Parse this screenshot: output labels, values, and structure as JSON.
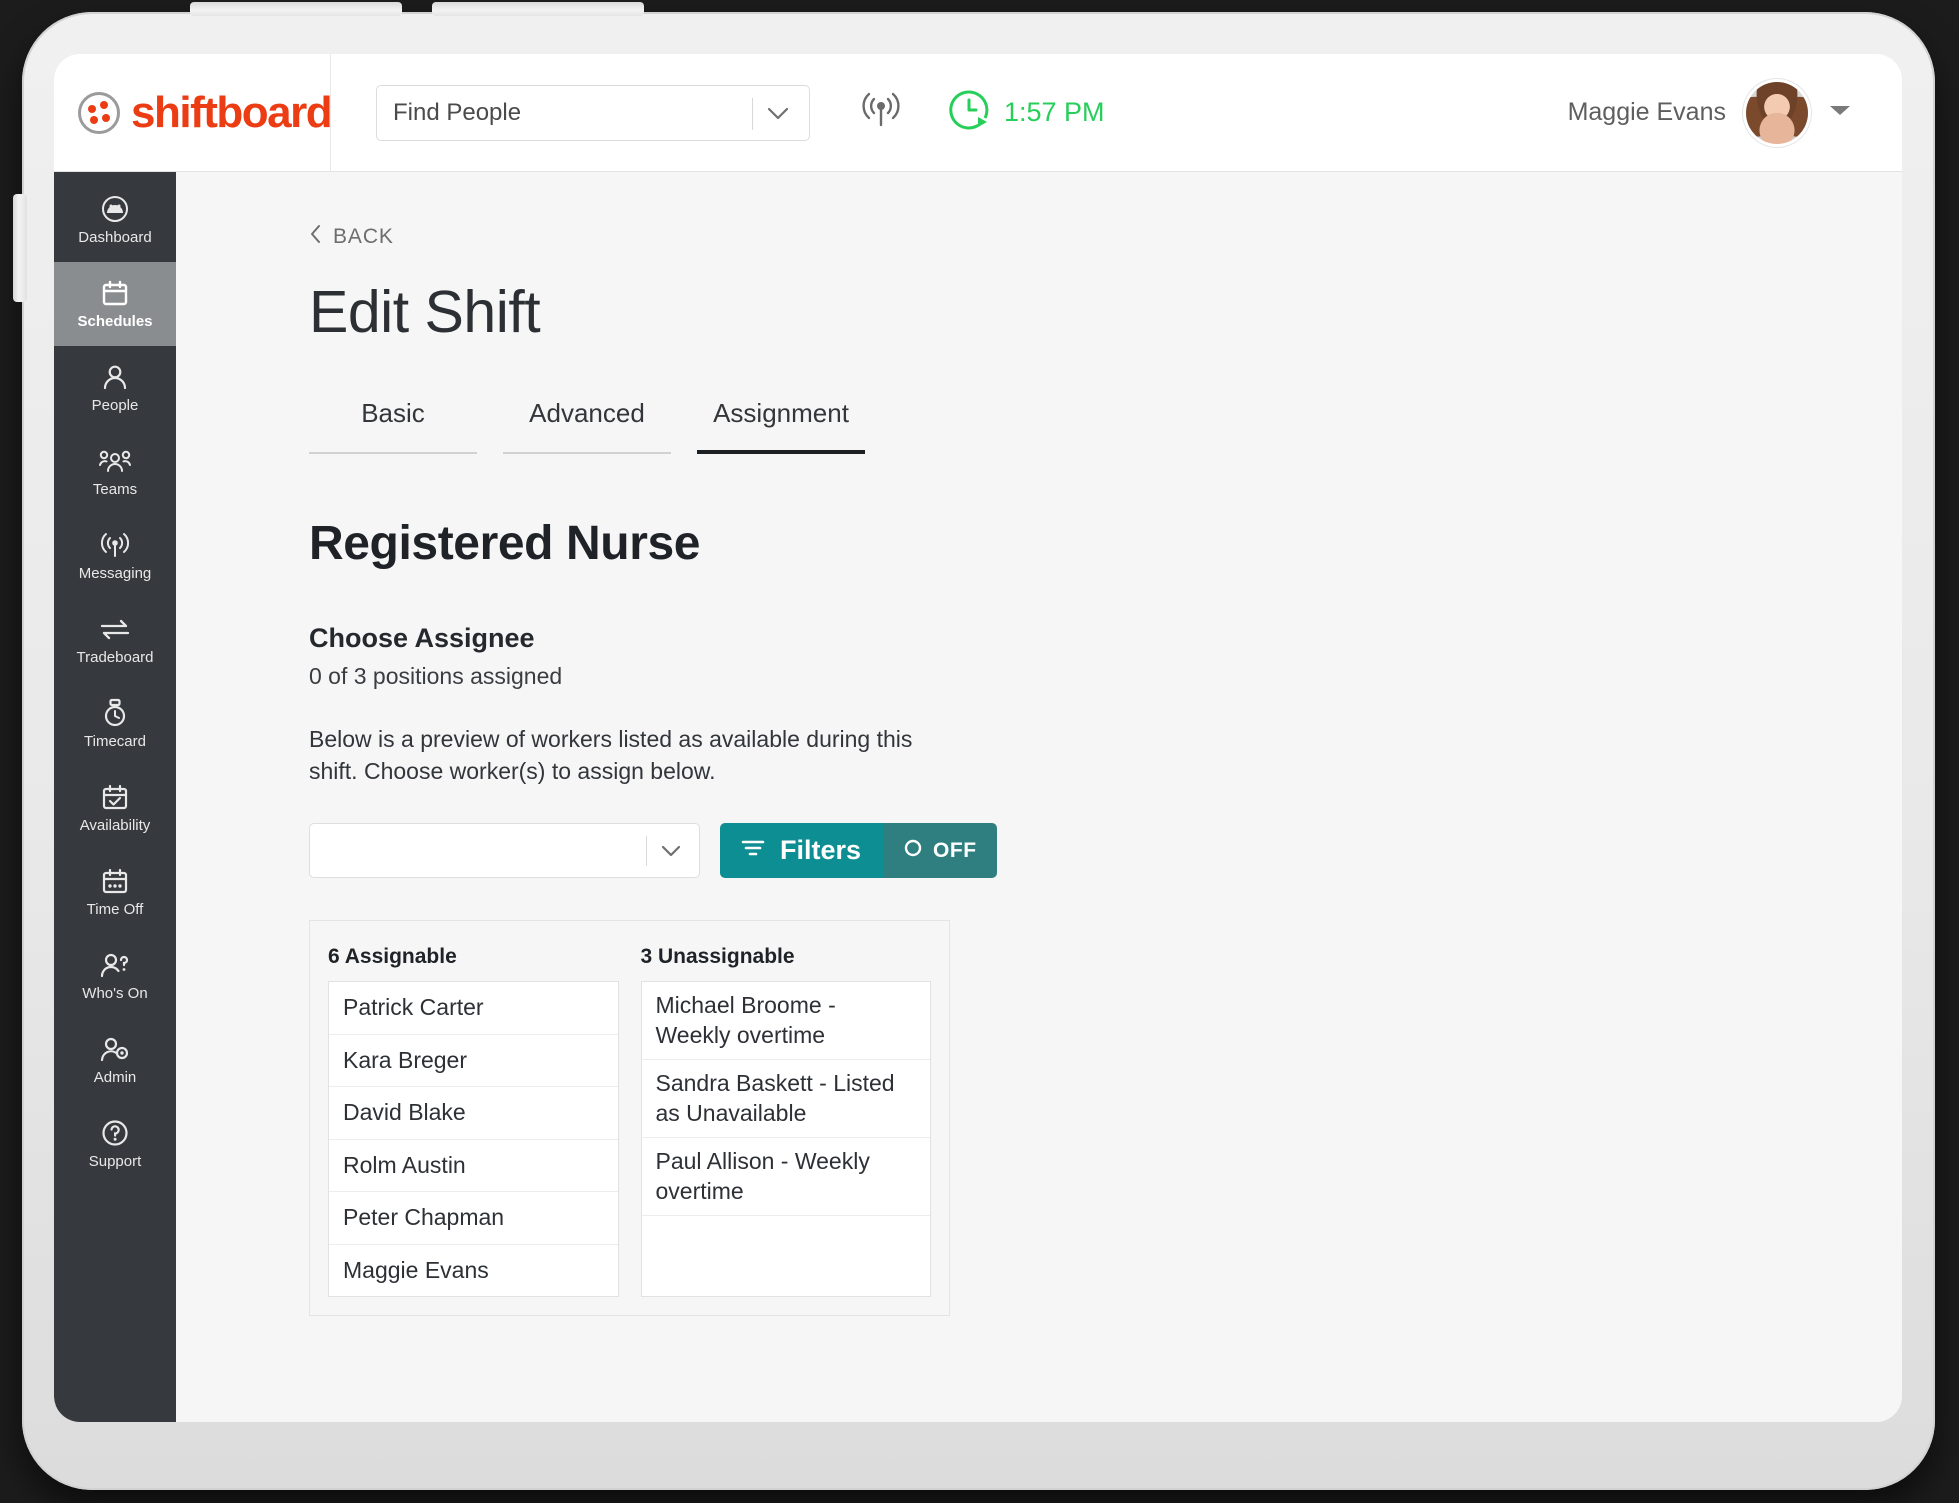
{
  "header": {
    "brand_name": "shiftboard",
    "brand_icon": "shiftboard-dots-logo-icon",
    "find_people": {
      "value": "Find People",
      "chevron_icon": "chevron-down-icon"
    },
    "broadcast_icon": "broadcast-antenna-icon",
    "clock_icon": "clock-play-icon",
    "clock_time": "1:57 PM",
    "clock_color": "#27cf5a",
    "user_name": "Maggie Evans",
    "avatar_icon": "user-avatar",
    "user_chevron_icon": "chevron-down-icon"
  },
  "sidebar": {
    "items": [
      {
        "label": "Dashboard",
        "icon": "gauge-icon",
        "active": false
      },
      {
        "label": "Schedules",
        "icon": "calendar-icon",
        "active": true
      },
      {
        "label": "People",
        "icon": "person-icon",
        "active": false
      },
      {
        "label": "Teams",
        "icon": "people-group-icon",
        "active": false
      },
      {
        "label": "Messaging",
        "icon": "broadcast-icon",
        "active": false
      },
      {
        "label": "Tradeboard",
        "icon": "swap-arrows-icon",
        "active": false
      },
      {
        "label": "Timecard",
        "icon": "stopwatch-icon",
        "active": false
      },
      {
        "label": "Availability",
        "icon": "calendar-check-icon",
        "active": false
      },
      {
        "label": "Time Off",
        "icon": "calendar-dots-icon",
        "active": false
      },
      {
        "label": "Who's On",
        "icon": "person-question-icon",
        "active": false
      },
      {
        "label": "Admin",
        "icon": "person-gear-icon",
        "active": false
      },
      {
        "label": "Support",
        "icon": "question-circle-icon",
        "active": false
      }
    ]
  },
  "main": {
    "back_label": "BACK",
    "back_icon": "chevron-left-icon",
    "page_title": "Edit Shift",
    "tabs": [
      {
        "label": "Basic",
        "active": false
      },
      {
        "label": "Advanced",
        "active": false
      },
      {
        "label": "Assignment",
        "active": true
      }
    ],
    "role_title": "Registered Nurse",
    "choose_assignee_heading": "Choose Assignee",
    "positions_assigned": "0 of 3 positions assigned",
    "preview_description": "Below is a preview of workers listed as available during this shift. Choose worker(s) to assign below.",
    "worker_select": {
      "value": "",
      "placeholder": "",
      "chevron_icon": "chevron-down-icon"
    },
    "filters_button": {
      "label": "Filters",
      "icon": "filter-lines-icon",
      "toggle_label": "OFF",
      "toggle_icon": "power-circle-icon",
      "color": "#0d8e92",
      "toggle_color": "#2f7f80"
    },
    "assignable": {
      "heading": "6 Assignable",
      "rows": [
        "Patrick Carter",
        "Kara Breger",
        "David Blake",
        "Rolm Austin",
        "Peter Chapman",
        "Maggie Evans"
      ]
    },
    "unassignable": {
      "heading": "3 Unassignable",
      "rows": [
        "Michael Broome - Weekly overtime",
        "Sandra Baskett - Listed as Unavailable",
        "Paul Allison - Weekly overtime"
      ]
    }
  }
}
